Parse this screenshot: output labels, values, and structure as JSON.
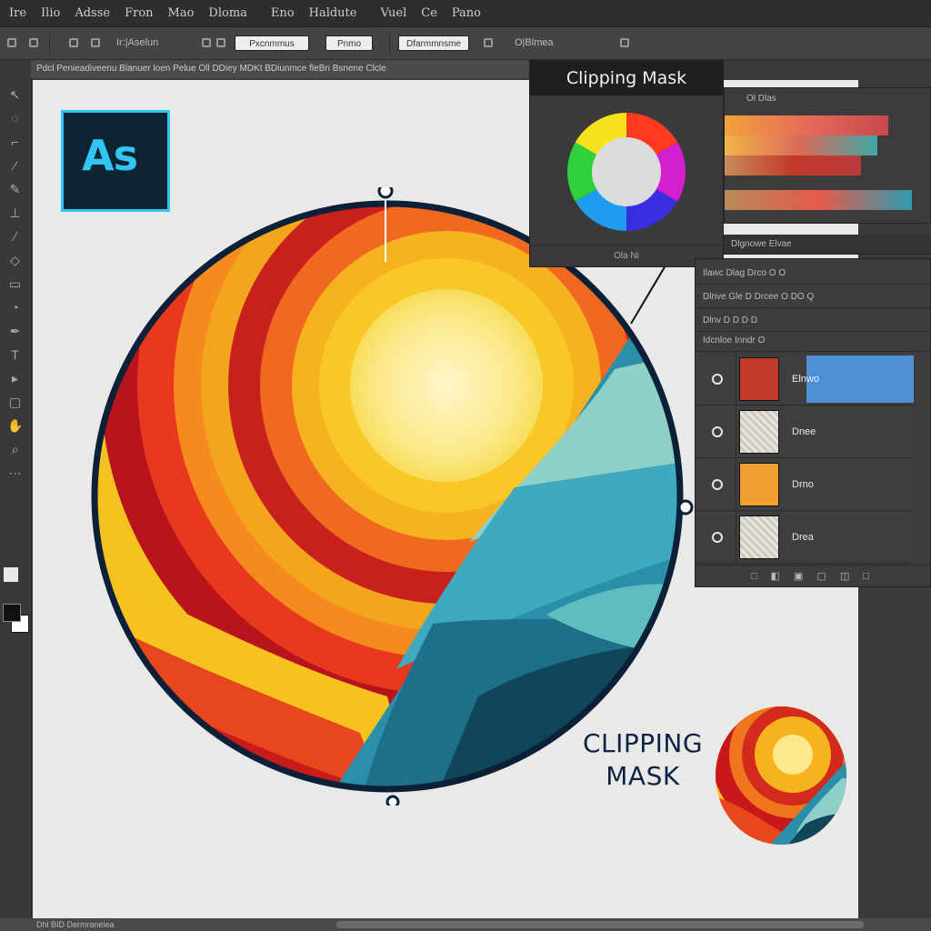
{
  "menu": [
    "Ire",
    "Ilio",
    "Adsse",
    "Fron",
    "Mao",
    "Dloma",
    "Eno",
    "Haldute",
    "Vuel",
    "Ce",
    "Pano"
  ],
  "options_bar": {
    "label_1": "Ir:|Aselun",
    "field_1": "Pxcnmmus",
    "field_2": "Pnmo",
    "field_3": "Dfarmmnsme",
    "label_2": "O|Blmea"
  },
  "doc_tab": "Pdcl Penieadiveenu Blanuer loen Pelue  Oll DDiey MDKt BDiunmce fleBn Bsnene  Clcle",
  "logo": {
    "text": "As",
    "bg": "#0f2433",
    "color": "#31c5f4"
  },
  "caption": {
    "line1": "CLIPPING",
    "line2": "MASK"
  },
  "mask_panel": {
    "title": "Clipping Mask",
    "footer": "Ola  Ni"
  },
  "gradient_panel": {
    "header": "Ol  Dlas"
  },
  "panel_strips": {
    "strip1": "Dlgnowe Elvae",
    "strip2": "Ilawc  Dlag  Drco  O O"
  },
  "layers_panel": {
    "row_head_1": "Dlnve  Gle  D  Drcee  O  DO  Q",
    "row_head_2": "Dlnv  D  D  D  D",
    "row_head_3": "Idcnloe Inndr  O",
    "items": [
      {
        "name": "Elnwo",
        "selected": true,
        "thumb": "#c23a2a"
      },
      {
        "name": "Dnee",
        "selected": false,
        "thumb": "#e8e4dc"
      },
      {
        "name": "Drno",
        "selected": false,
        "thumb": "#f0a030"
      },
      {
        "name": "Drea",
        "selected": false,
        "thumb": "#e8e4dc"
      }
    ],
    "footer": "□ ◧ ▣ ▢ ◫ □"
  },
  "status_bar": "Dhl  BID   Dermranelea",
  "colors": {
    "accent": "#4e8fd6",
    "canvas": "#e9e9e7",
    "caption": "#0f2347"
  }
}
